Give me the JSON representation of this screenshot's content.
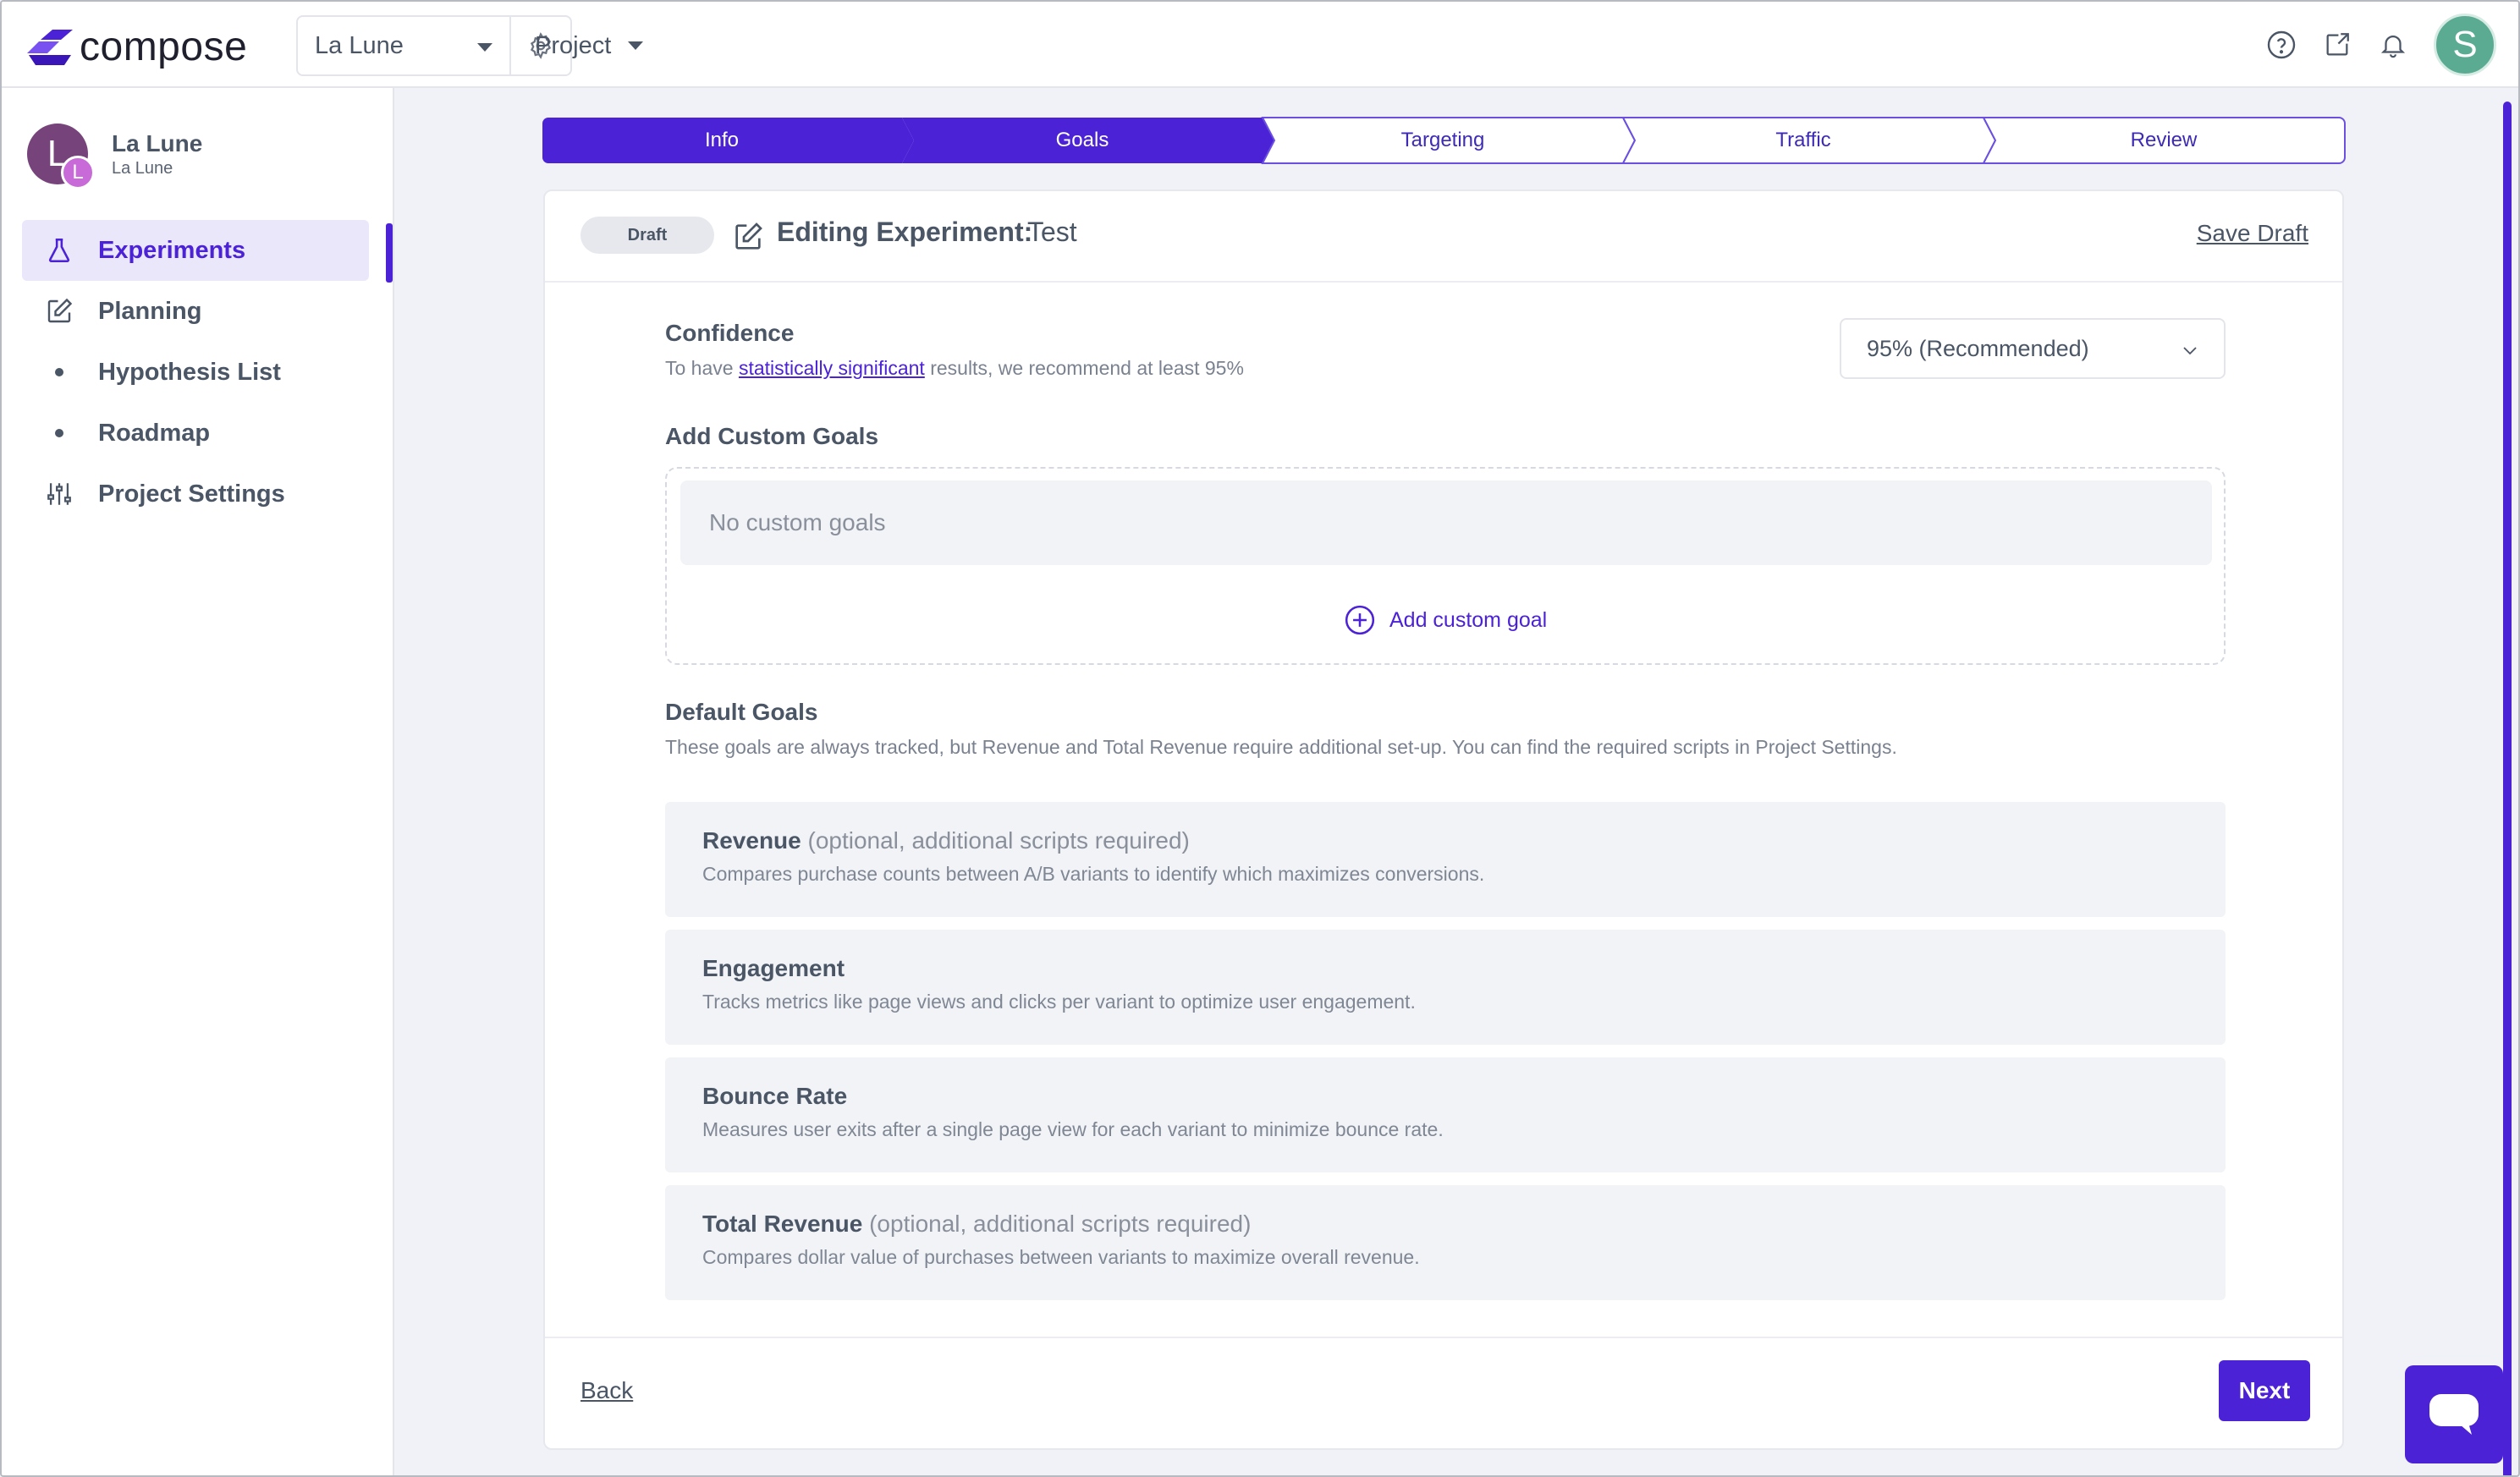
{
  "app": {
    "logo_text": "compose",
    "workspace": "La Lune",
    "project_menu": "Project",
    "avatar_initial": "S",
    "brand_color": "#4b22d6"
  },
  "sidebar": {
    "org_initial": "L",
    "org_sub_initial": "L",
    "org_name": "La Lune",
    "org_sub": "La Lune",
    "items": [
      {
        "label": "Experiments",
        "icon": "flask-icon"
      },
      {
        "label": "Planning",
        "icon": "edit-icon"
      },
      {
        "label": "Hypothesis List",
        "icon": "bullet"
      },
      {
        "label": "Roadmap",
        "icon": "bullet"
      },
      {
        "label": "Project Settings",
        "icon": "sliders-icon"
      }
    ]
  },
  "stepper": {
    "steps": [
      "Info",
      "Goals",
      "Targeting",
      "Traffic",
      "Review"
    ],
    "current": 1
  },
  "header": {
    "status": "Draft",
    "title": "Editing Experiment:",
    "name": "Test",
    "save_draft": "Save Draft"
  },
  "confidence": {
    "title": "Confidence",
    "desc_prefix": "To have ",
    "desc_link": "statistically significant",
    "desc_suffix": " results, we recommend at least 95%",
    "selected": "95% (Recommended)"
  },
  "custom_goals": {
    "title": "Add Custom Goals",
    "empty": "No custom goals",
    "add_label": "Add custom goal"
  },
  "default_goals": {
    "title": "Default Goals",
    "desc": "These goals are always tracked, but Revenue and Total Revenue require additional set-up. You can find the required scripts in Project Settings.",
    "items": [
      {
        "title": "Revenue",
        "note": "(optional, additional scripts required)",
        "desc": "Compares purchase counts between A/B variants to identify which maximizes conversions."
      },
      {
        "title": "Engagement",
        "note": "",
        "desc": "Tracks metrics like page views and clicks per variant to optimize user engagement."
      },
      {
        "title": "Bounce Rate",
        "note": "",
        "desc": "Measures user exits after a single page view for each variant to minimize bounce rate."
      },
      {
        "title": "Total Revenue",
        "note": "(optional, additional scripts required)",
        "desc": "Compares dollar value of purchases between variants to maximize overall revenue."
      }
    ]
  },
  "footer": {
    "back": "Back",
    "next": "Next"
  }
}
